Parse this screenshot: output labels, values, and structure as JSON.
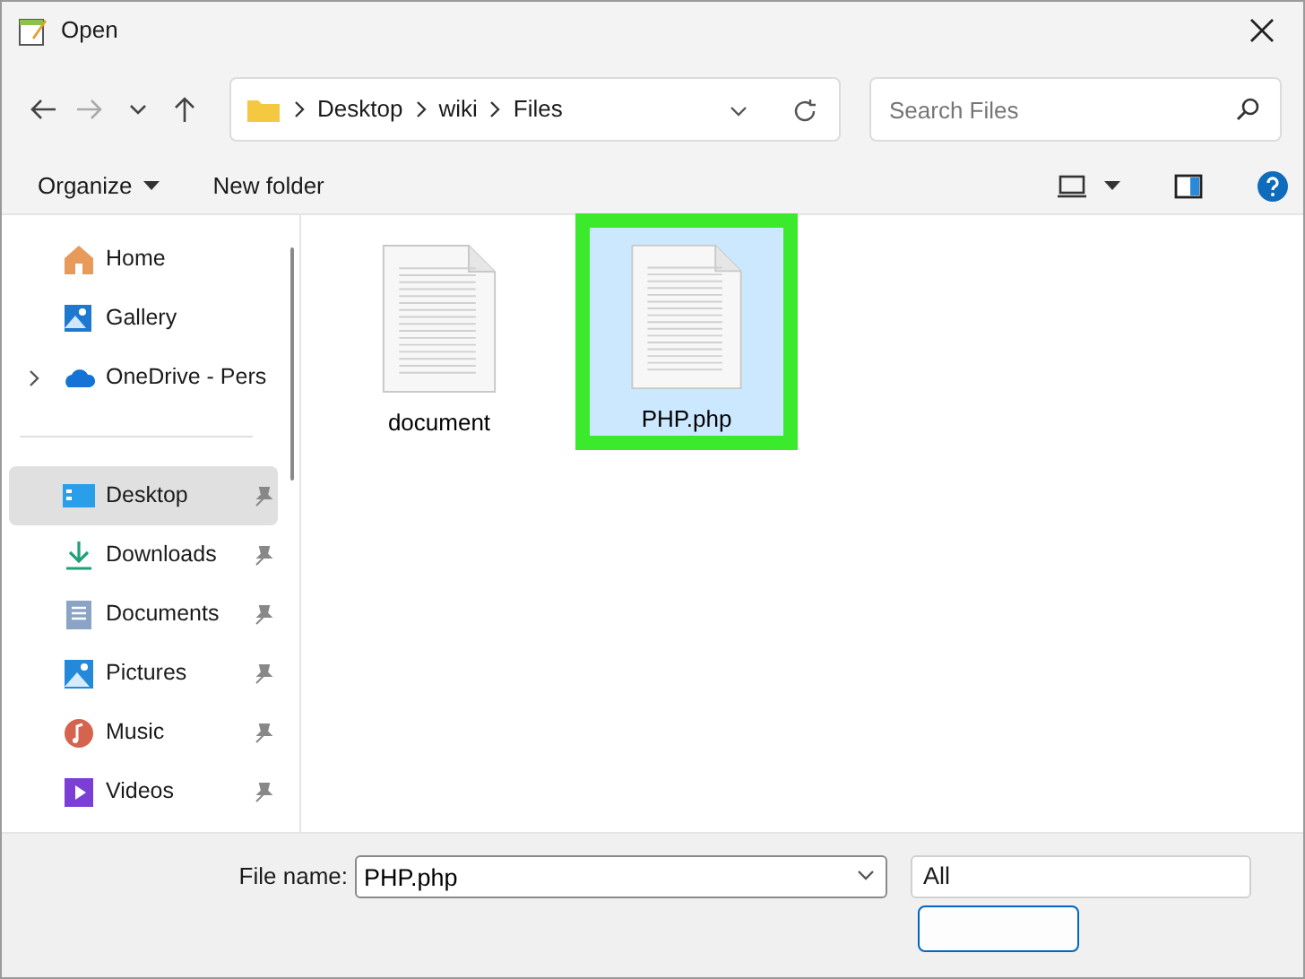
{
  "window": {
    "title": "Open"
  },
  "nav": {
    "path": [
      "Desktop",
      "wiki",
      "Files"
    ],
    "search_placeholder": "Search Files"
  },
  "toolbar": {
    "organize": "Organize",
    "new_folder": "New folder"
  },
  "sidebar": {
    "items": [
      {
        "label": "Home",
        "kind": "home",
        "pinned": false,
        "expandable": false,
        "selected": false
      },
      {
        "label": "Gallery",
        "kind": "gallery",
        "pinned": false,
        "expandable": false,
        "selected": false
      },
      {
        "label": "OneDrive - Pers",
        "kind": "cloud",
        "pinned": false,
        "expandable": true,
        "selected": false
      },
      {
        "kind": "divider"
      },
      {
        "label": "Desktop",
        "kind": "desktop",
        "pinned": true,
        "expandable": false,
        "selected": true
      },
      {
        "label": "Downloads",
        "kind": "download",
        "pinned": true,
        "expandable": false,
        "selected": false
      },
      {
        "label": "Documents",
        "kind": "documents",
        "pinned": true,
        "expandable": false,
        "selected": false
      },
      {
        "label": "Pictures",
        "kind": "pictures",
        "pinned": true,
        "expandable": false,
        "selected": false
      },
      {
        "label": "Music",
        "kind": "music",
        "pinned": true,
        "expandable": false,
        "selected": false
      },
      {
        "label": "Videos",
        "kind": "videos",
        "pinned": true,
        "expandable": false,
        "selected": false
      }
    ]
  },
  "files": [
    {
      "name": "document",
      "selected": false,
      "highlighted": false
    },
    {
      "name": "PHP.php",
      "selected": true,
      "highlighted": true
    }
  ],
  "footer": {
    "file_name_label": "File name:",
    "file_name": "PHP.php",
    "file_type": "All"
  }
}
